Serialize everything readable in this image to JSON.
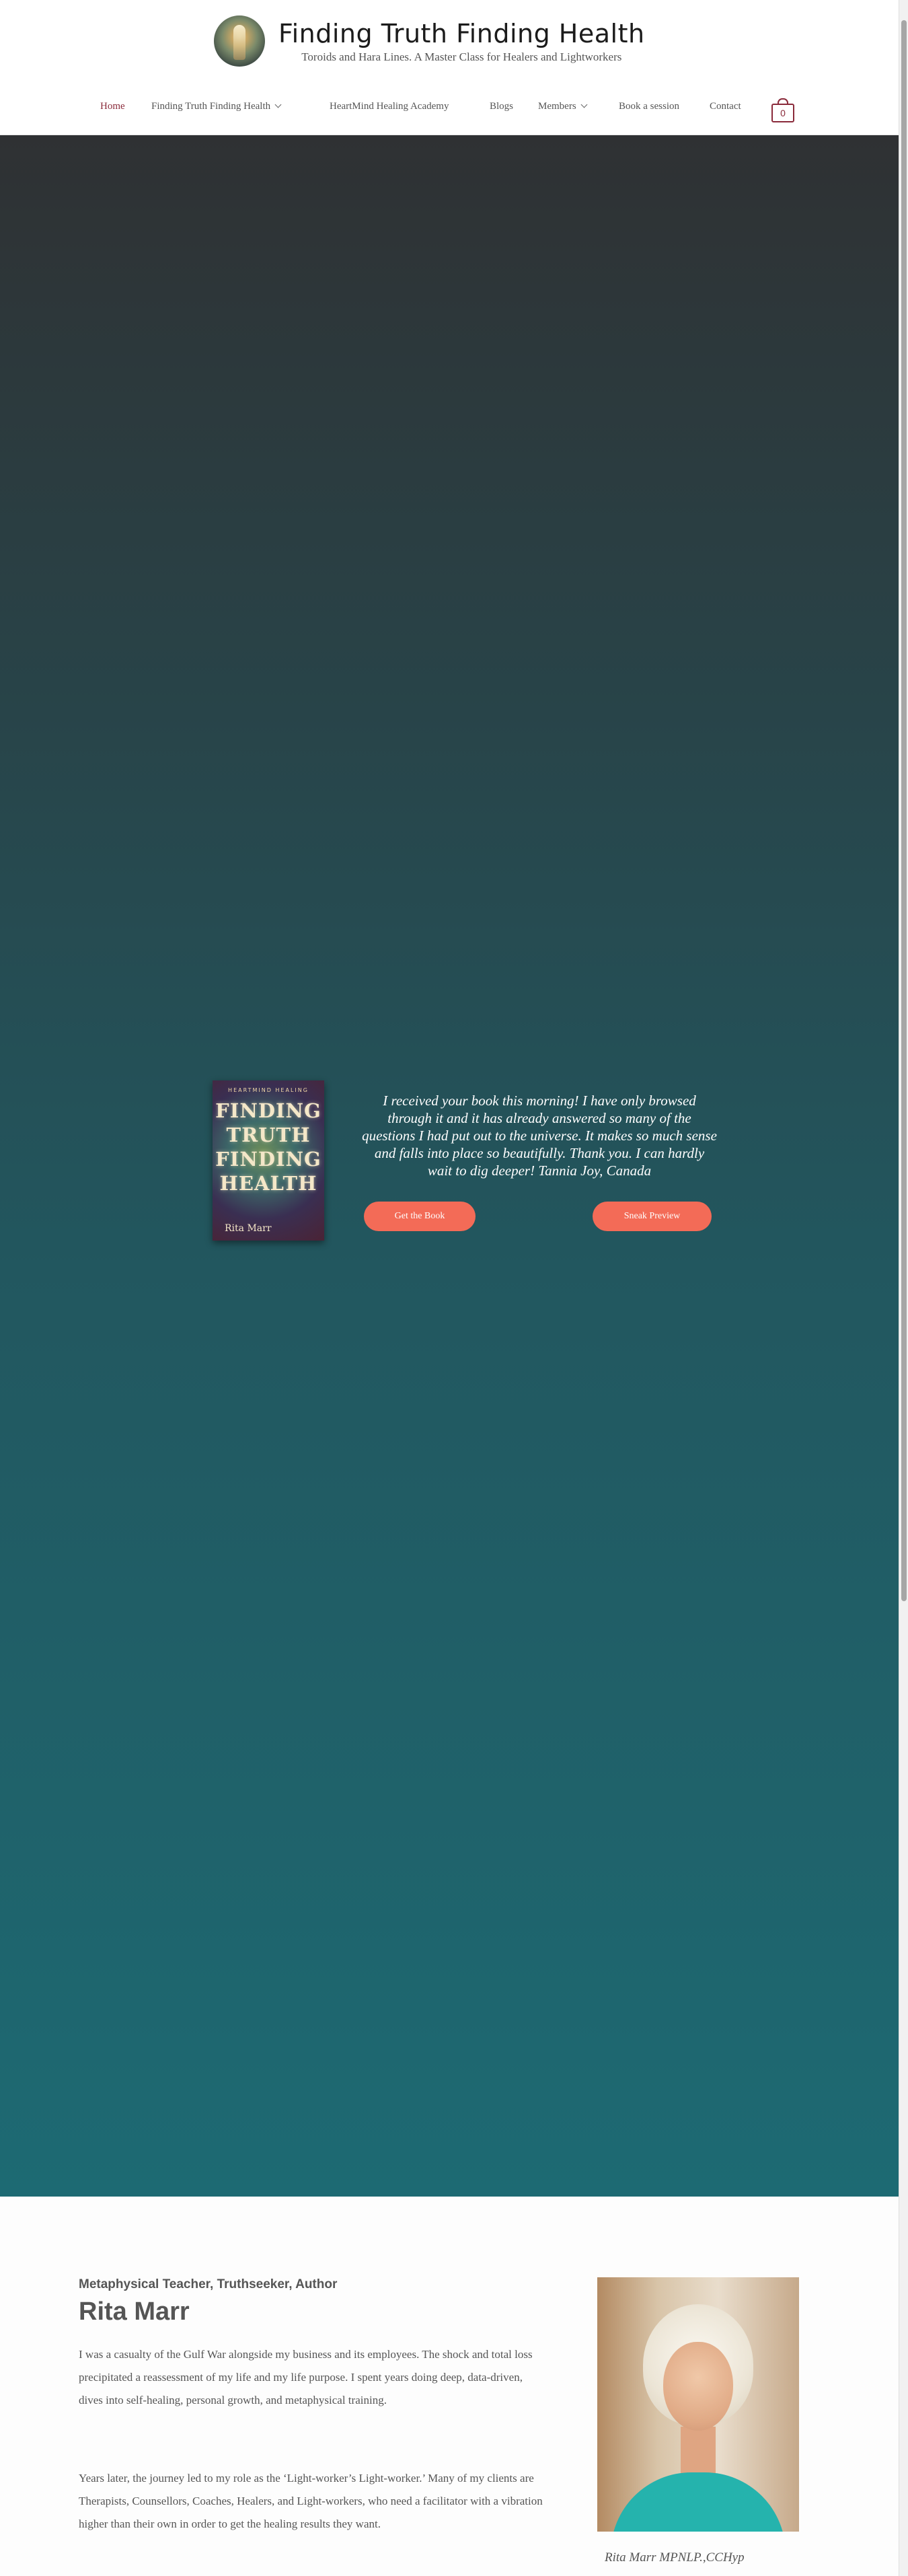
{
  "header": {
    "site_title": "Finding Truth Finding Health",
    "tagline": "Toroids and Hara Lines. A Master Class for Healers and Lightworkers",
    "logo_icon": "logo-orb-icon"
  },
  "nav": {
    "items": [
      {
        "label": "Home",
        "active": true
      },
      {
        "label": "Finding Truth Finding Health",
        "has_dropdown": true
      },
      {
        "label": "HeartMind Healing Academy"
      },
      {
        "label": "Blogs"
      },
      {
        "label": "Members",
        "has_dropdown": true
      },
      {
        "label": "Book a session"
      },
      {
        "label": "Contact"
      }
    ],
    "cart_count": "0",
    "active_color": "#8a2a3a"
  },
  "hero": {
    "book_cover": {
      "series": "HEARTMIND HEALING",
      "title_lines": [
        "FINDING",
        "TRUTH",
        "FINDING",
        "HEALTH"
      ],
      "author": "Rita Marr"
    },
    "quote": "I received your book this morning! I have only browsed through it and it has already answered so many of the questions I had put out to the universe. It makes so much sense and falls into place so beautifully. Thank you. I can hardly wait to dig deeper! Tannia Joy, Canada",
    "buttons": {
      "get_book": "Get the Book",
      "sneak_preview": "Sneak Preview"
    },
    "button_color": "#f36b57"
  },
  "about": {
    "kicker": "Metaphysical Teacher, Truthseeker, Author",
    "name": "Rita Marr",
    "paragraph_1": "I was a casualty of the Gulf War alongside my business and its employees. The shock and total loss precipitated a reassessment of my life and my life purpose. I spent years doing deep, data-driven, dives into self-healing, personal growth, and metaphysical training.",
    "paragraph_2": "Years later, the journey led to my role as the ‘Light-worker’s Light-worker.’ Many of my clients are Therapists, Counsellors, Coaches, Healers, and Light-workers, who need a facilitator with a vibration higher than their own in order to get the healing results they want.",
    "portrait_caption": "Rita Marr MPNLP.,CCHyp"
  }
}
